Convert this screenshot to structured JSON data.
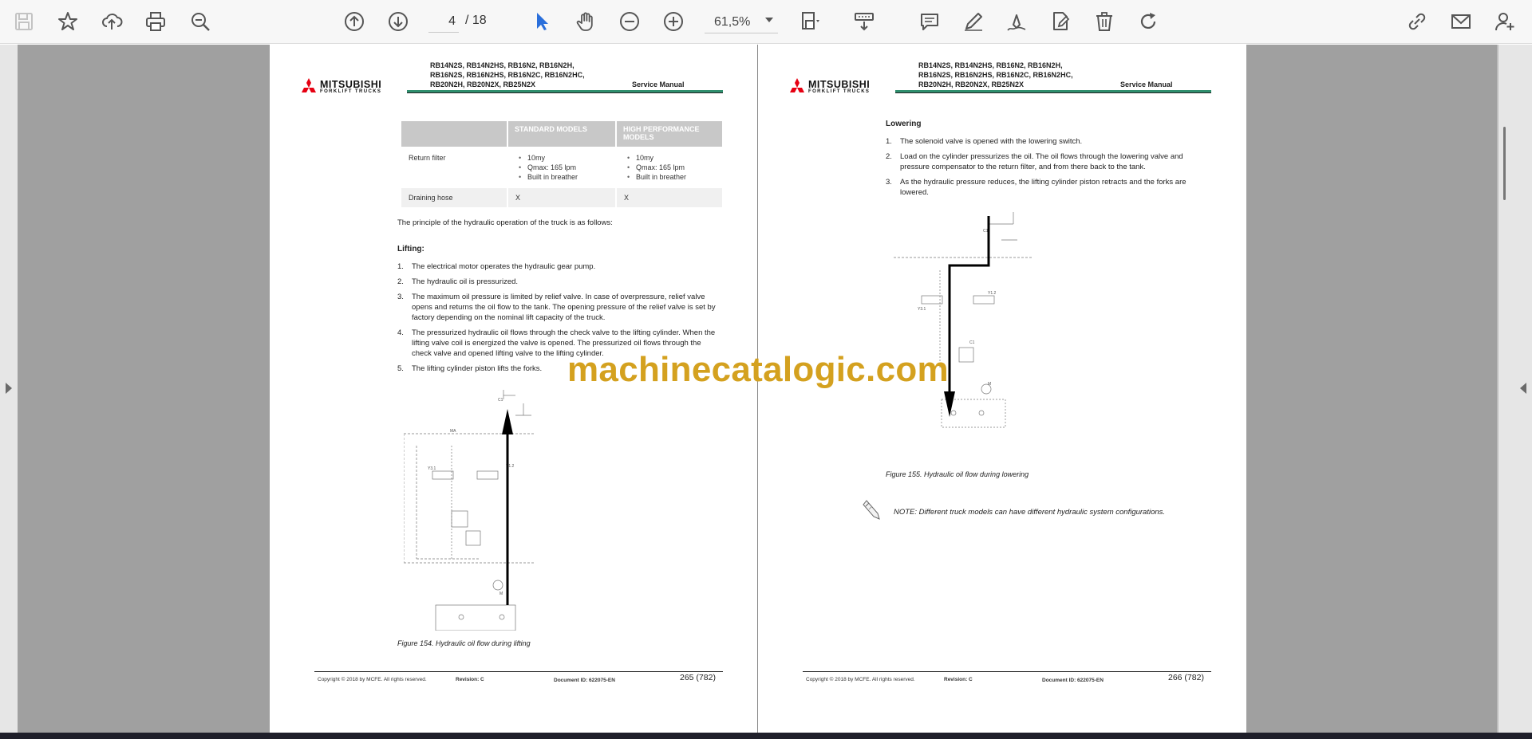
{
  "toolbar": {
    "current_page": "4",
    "total_pages": "/ 18",
    "zoom": "61,5%",
    "icons": [
      "save-icon",
      "bookmark-star-icon",
      "upload-cloud-icon",
      "print-icon",
      "zoom-search-icon",
      "previous-page-icon",
      "next-page-icon",
      "select-cursor-icon",
      "hand-tool-icon",
      "zoom-out-icon",
      "zoom-in-icon",
      "page-fit-icon",
      "scroll-mode-icon",
      "comment-icon",
      "pen-icon",
      "sign-icon",
      "edit-doc-icon",
      "delete-icon",
      "redo-icon",
      "share-link-icon",
      "email-icon",
      "add-user-icon"
    ]
  },
  "header": {
    "brand": "MITSUBISHI",
    "brand_sub": "FORKLIFT TRUCKS",
    "models": [
      "RB14N2S, RB14N2HS, RB16N2, RB16N2H,",
      "RB16N2S, RB16N2HS, RB16N2C, RB16N2HC,",
      "RB20N2H, RB20N2X, RB25N2X"
    ],
    "manual": "Service Manual"
  },
  "left_page": {
    "table": {
      "headers": [
        "",
        "STANDARD MODELS",
        "HIGH PERFORMANCE MODELS"
      ],
      "rows": [
        {
          "label": "Return filter",
          "standard": [
            "10my",
            "Qmax: 165 lpm",
            "Built in breather"
          ],
          "high": [
            "10my",
            "Qmax: 165 lpm",
            "Built in breather"
          ]
        },
        {
          "label": "Draining hose",
          "standard": "X",
          "high": "X"
        }
      ]
    },
    "intro": "The principle of the hydraulic operation of the truck is as follows:",
    "section": "Lifting:",
    "steps": [
      "The electrical motor operates the hydraulic gear pump.",
      "The hydraulic oil is pressurized.",
      "The maximum oil pressure is limited by relief valve. In case of overpressure, relief valve opens and returns the oil flow to the tank. The opening pressure of the relief valve is set by factory depending on the nominal lift capacity of the truck.",
      "The pressurized hydraulic oil flows through the check valve to the lifting cylinder. When the lifting valve coil is energized the valve is opened. The pressurized oil flows through the check valve and opened lifting valve to the lifting cylinder.",
      "The lifting cylinder piston lifts the forks."
    ],
    "figure_caption": "Figure 154. Hydraulic oil flow during lifting",
    "footer": {
      "copyright": "Copyright © 2018 by MCFE. All rights reserved.",
      "revision": "Revision: C",
      "document": "Document ID: 622075-EN",
      "page": "265 (782)"
    }
  },
  "right_page": {
    "section": "Lowering",
    "steps": [
      "The solenoid valve is opened with the lowering switch.",
      "Load on the cylinder pressurizes the oil. The oil flows through the lowering valve and pressure compensator to the return filter, and from there back to the tank.",
      "As the hydraulic pressure reduces, the lifting cylinder piston retracts and the forks are lowered."
    ],
    "figure_caption": "Figure 155. Hydraulic oil flow during lowering",
    "note": "NOTE: Different truck models can have different hydraulic system configurations.",
    "footer": {
      "copyright": "Copyright © 2018 by MCFE. All rights reserved.",
      "revision": "Revision: C",
      "document": "Document ID: 622075-EN",
      "page": "266 (782)"
    }
  },
  "watermark": "machinecatalogic.com",
  "colors": {
    "toolbar_bg": "#f7f7f7",
    "workspace": "#a0a0a0",
    "header_green": "#2f8f6e",
    "watermark": "#d4a11f",
    "mitsubishi_red": "#e60012",
    "select_blue": "#2a6fdb"
  }
}
